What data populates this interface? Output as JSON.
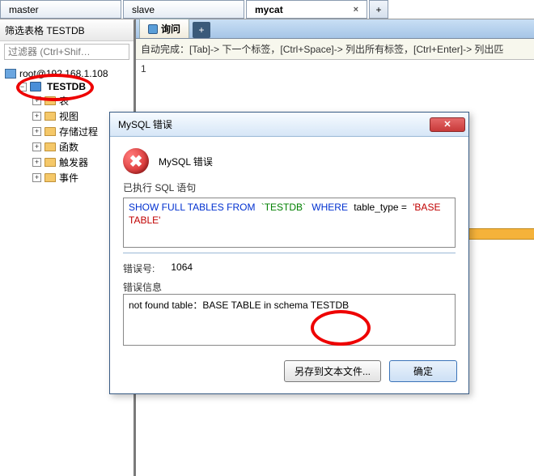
{
  "tabs": [
    {
      "label": "master",
      "closable": false
    },
    {
      "label": "slave",
      "closable": false
    },
    {
      "label": "mycat",
      "closable": true,
      "active": true
    }
  ],
  "sidebar": {
    "filter_title": "筛选表格 TESTDB",
    "filter_placeholder": "过滤器 (Ctrl+Shif…",
    "server": "root@192.168.1.108",
    "database": "TESTDB",
    "nodes": [
      {
        "label": "表"
      },
      {
        "label": "视图"
      },
      {
        "label": "存储过程"
      },
      {
        "label": "函数"
      },
      {
        "label": "触发器"
      },
      {
        "label": "事件"
      }
    ]
  },
  "content": {
    "tab_label": "询问",
    "hint": "自动完成：[Tab]-> 下一个标签，[Ctrl+Space]-> 列出所有标签，[Ctrl+Enter]-> 列出匹",
    "editor_line": "1"
  },
  "dialog": {
    "title": "MySQL 错误",
    "header_text": "MySQL 错误",
    "executed_label": "已执行 SQL 语句",
    "sql_parts": {
      "p1": "SHOW FULL TABLES FROM",
      "p2": "`TESTDB`",
      "p3": "WHERE",
      "p4": "table_type =",
      "p5": "'BASE TABLE'"
    },
    "errno_label": "错误号:",
    "errno_value": "1064",
    "errmsg_label": "错误信息",
    "errmsg_text": "not found table：BASE TABLE in schema TESTDB",
    "btn_save": "另存到文本文件...",
    "btn_ok": "确定"
  }
}
